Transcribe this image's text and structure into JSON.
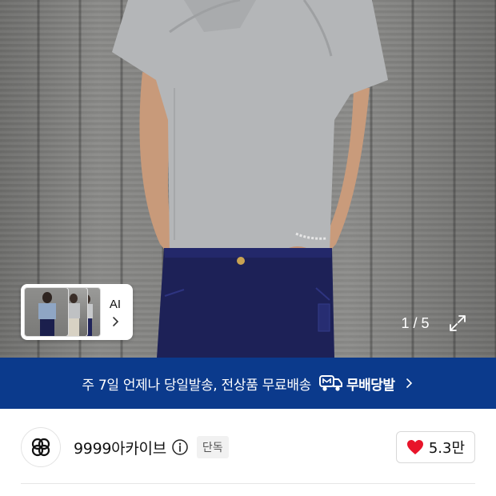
{
  "photo": {
    "counter": "1 / 5",
    "icons": {
      "expand": "expand-arrows-icon"
    }
  },
  "ai_card": {
    "label": "AI",
    "icons": {
      "chevron": "chevron-right-icon"
    }
  },
  "banner": {
    "text": "주 7일 언제나 당일발송, 전상품 무료배송",
    "badge_text": "무배당발",
    "background": "#0b3a8c",
    "icons": {
      "truck": "delivery-truck-icon",
      "chevron": "chevron-right-icon"
    }
  },
  "shop": {
    "name": "9999아카이브",
    "exclusive_label": "단독",
    "likes": "5.3만",
    "heart_color": "#e8142a",
    "icons": {
      "logo": "shop-logo-icon",
      "info": "info-icon",
      "heart": "heart-icon"
    }
  }
}
